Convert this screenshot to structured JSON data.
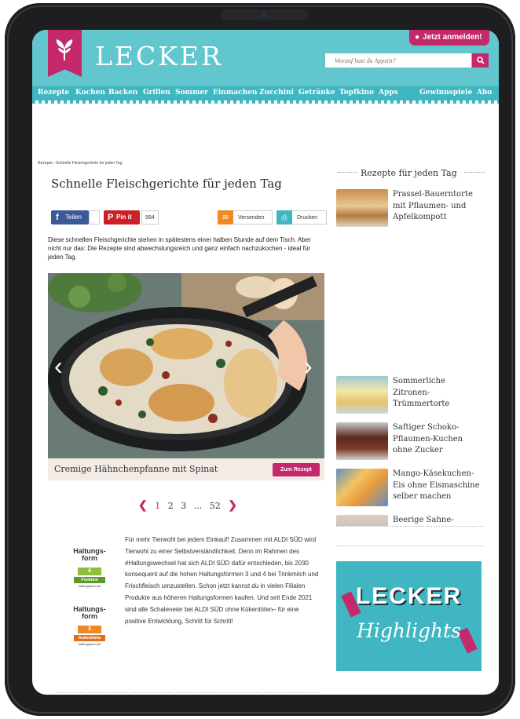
{
  "header": {
    "brand": "LECKER",
    "login_label": "Jetzt anmelden!",
    "search_placeholder": "Worauf hast du Appetit?"
  },
  "nav": {
    "items": [
      "Rezepte",
      "Kochen",
      "Backen",
      "Grillen",
      "Sommer",
      "Einmachen",
      "Zucchini",
      "Getränke",
      "Topfkino",
      "Apps",
      "Gewinnspiele",
      "Abo"
    ]
  },
  "page": {
    "breadcrumb": "Rezepte › Schnelle Fleischgerichte für jeden Tag",
    "title": "Schnelle Fleischgerichte für jeden Tag",
    "intro": "Diese schnellen Fleischgerichte stehen in spätestens einer halben Stunde auf dem Tisch. Aber nicht nur das: Die Rezepte sind abwechslungsreich und ganz einfach nachzukochen - ideal für jeden Tag."
  },
  "share": {
    "facebook_label": "Teilen",
    "pinterest_label": "Pin it",
    "pinterest_count": "994",
    "email_label": "Versenden",
    "print_label": "Drucken"
  },
  "slider": {
    "caption": "Cremige Hähnchenpfanne mit Spinat",
    "button_label": "Zum Rezept"
  },
  "pagination": {
    "pages": [
      "1",
      "2",
      "3",
      "...",
      "52"
    ],
    "current": "1"
  },
  "info": {
    "logo_title": "Haltungs-form",
    "logo1_number": "4",
    "logo1_label": "Premium",
    "logo2_number": "3",
    "logo2_label": "Außenklima",
    "logo_url": "haltungsform.de",
    "text": "Für mehr Tierwohl bei jedem Einkauf! Zusammen mit ALDI SÜD wird Tierwohl zu einer Selbstverständlichkeit. Denn im Rahmen des #Haltungswechsel hat sich ALDI SÜD dafür entschieden, bis 2030 konsequent auf die hohen Haltungsformen 3 und 4 bei Trinkmilch und Frischfleisch umzustellen. Schon jetzt kannst du in vielen Filialen Produkte aus höheren Haltungsformen kaufen. Und seit Ende 2021 sind alle Schaleneier bei ALDI SÜD ohne Kükentöten– für eine positive Entwicklung, Schritt für Schritt!"
  },
  "sidebar": {
    "heading": "Rezepte für jeden Tag",
    "items": [
      {
        "title": "Prassel-Bauerntorte mit Pflaumen- und Apfelkompott"
      },
      {
        "title": "Sommerliche Zitronen-Trümmertorte"
      },
      {
        "title": "Saftiger Schoko-Pflaumen-Kuchen ohne Zucker"
      },
      {
        "title": "Mango-Käsekuchen-Eis ohne Eismaschine selber machen"
      },
      {
        "title": "Beerige Sahne-"
      }
    ],
    "banner_top": "LECKER",
    "banner_bottom": "Highlights"
  },
  "icons": {
    "user": "user-icon",
    "search": "search-icon",
    "mail": "mail-icon",
    "print": "print-icon"
  },
  "colors": {
    "teal": "#62c6cf",
    "magenta": "#c3296b",
    "facebook": "#3b5998",
    "pinterest": "#cb2027"
  }
}
